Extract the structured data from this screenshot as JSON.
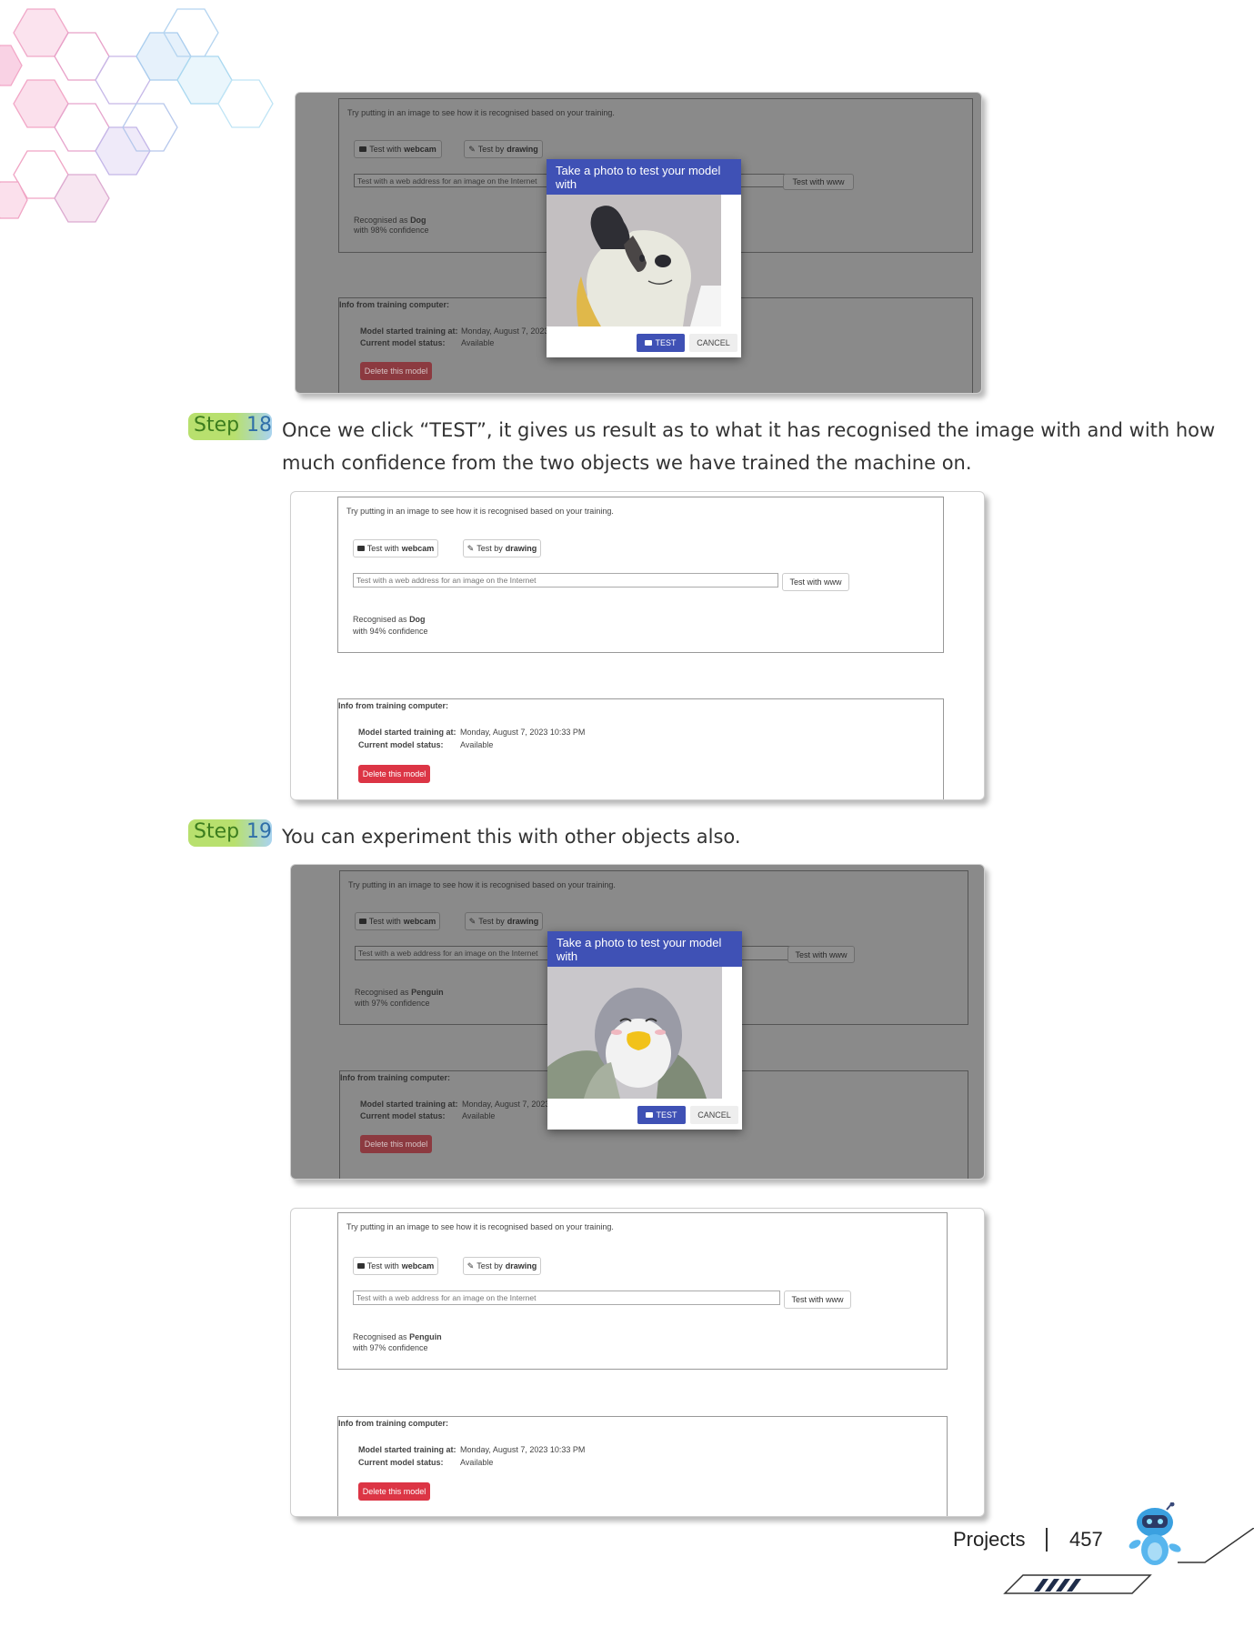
{
  "screens": {
    "s1": {
      "hint": "Try putting in an image to see how it is recognised based on your training.",
      "webcam_pre": "Test with",
      "webcam_bold": "webcam",
      "draw_pre": "Test by",
      "draw_bold": "drawing",
      "url_placeholder": "Test with a web address for an image on the Internet",
      "www_btn": "Test with www",
      "rec_pre": "Recognised as",
      "rec_label": "Dog",
      "rec_conf": "with 98% confidence",
      "info_title": "Info from training computer:",
      "started_label": "Model started training at:",
      "started_value": "Monday, August 7, 2023",
      "status_label": "Current model status:",
      "status_value": "Available",
      "delete_btn": "Delete this model",
      "modal_title": "Take a photo to test your model with",
      "modal_test": "TEST",
      "modal_cancel": "CANCEL"
    },
    "s2": {
      "hint": "Try putting in an image to see how it is recognised based on your training.",
      "webcam_pre": "Test with",
      "webcam_bold": "webcam",
      "draw_pre": "Test by",
      "draw_bold": "drawing",
      "url_placeholder": "Test with a web address for an image on the Internet",
      "www_btn": "Test with www",
      "rec_pre": "Recognised as",
      "rec_label": "Dog",
      "rec_conf": "with 94% confidence",
      "info_title": "Info from training computer:",
      "started_label": "Model started training at:",
      "started_value": "Monday, August 7, 2023 10:33 PM",
      "status_label": "Current model status:",
      "status_value": "Available",
      "delete_btn": "Delete this model"
    },
    "s3": {
      "hint": "Try putting in an image to see how it is recognised based on your training.",
      "webcam_pre": "Test with",
      "webcam_bold": "webcam",
      "draw_pre": "Test by",
      "draw_bold": "drawing",
      "url_placeholder": "Test with a web address for an image on the Internet",
      "www_btn": "Test with www",
      "rec_pre": "Recognised as",
      "rec_label": "Penguin",
      "rec_conf": "with 97% confidence",
      "info_title": "Info from training computer:",
      "started_label": "Model started training at:",
      "started_value": "Monday, August 7, 2023",
      "status_label": "Current model status:",
      "status_value": "Available",
      "delete_btn": "Delete this model",
      "modal_title": "Take a photo to test your model with",
      "modal_test": "TEST",
      "modal_cancel": "CANCEL"
    },
    "s4": {
      "hint": "Try putting in an image to see how it is recognised based on your training.",
      "webcam_pre": "Test with",
      "webcam_bold": "webcam",
      "draw_pre": "Test by",
      "draw_bold": "drawing",
      "url_placeholder": "Test with a web address for an image on the Internet",
      "www_btn": "Test with www",
      "rec_pre": "Recognised as",
      "rec_label": "Penguin",
      "rec_conf": "with 97% confidence",
      "info_title": "Info from training computer:",
      "started_label": "Model started training at:",
      "started_value": "Monday, August 7, 2023 10:33 PM",
      "status_label": "Current model status:",
      "status_value": "Available",
      "delete_btn": "Delete this model"
    }
  },
  "steps": {
    "word": "Step",
    "s18_num": "18",
    "s18_line1": "Once we click “TEST”, it gives us result as to what it has recognised the image with and with how",
    "s18_line2": "much confidence from the two objects we have trained the machine on.",
    "s19_num": "19",
    "s19_text": "You can experiment this with other objects also."
  },
  "footer": {
    "section": "Projects",
    "page": "457"
  },
  "colors": {
    "primary": "#3f51b5",
    "danger": "#dc3545",
    "step_green": "#b8e06e",
    "step_blue": "#a9d3f0"
  }
}
